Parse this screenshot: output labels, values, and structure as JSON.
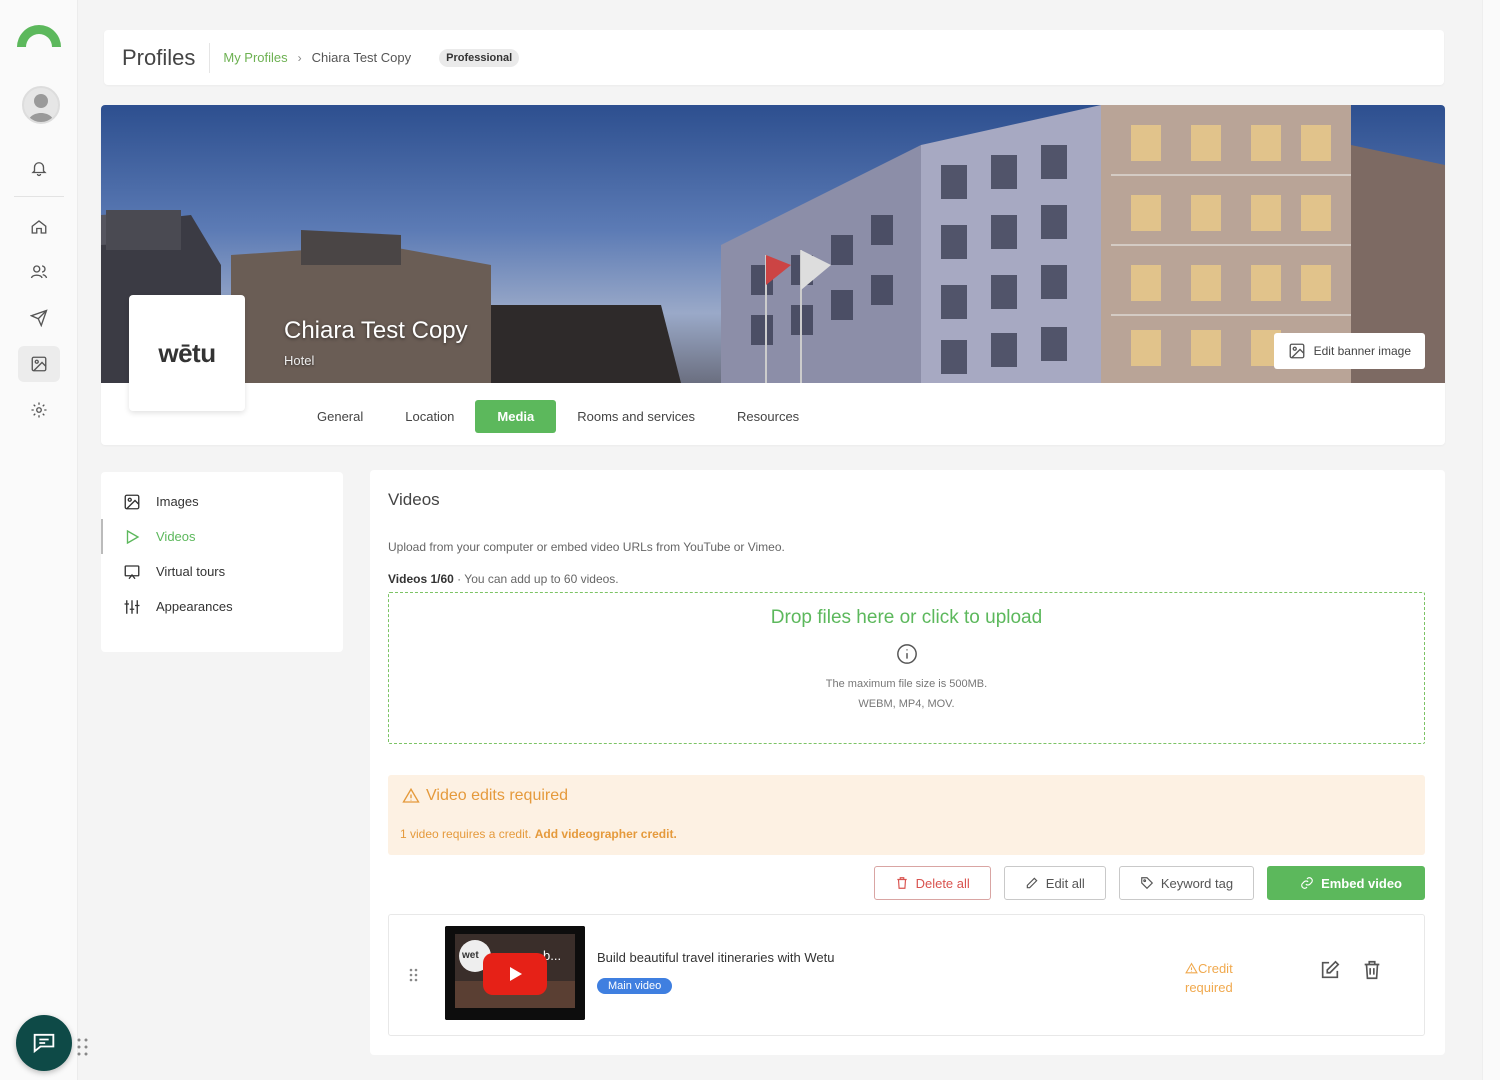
{
  "app": {
    "brand_color": "#5cb85c",
    "warning_color": "#e59a3c"
  },
  "rail": {
    "icons": [
      "logo-icon",
      "avatar",
      "bell-icon",
      "home-icon",
      "users-icon",
      "send-icon",
      "image-icon",
      "gear-icon"
    ],
    "active": "image-icon"
  },
  "header": {
    "title": "Profiles",
    "breadcrumb": {
      "link": "My Profiles",
      "separator": "›",
      "current": "Chiara Test Copy"
    },
    "badge": "Professional"
  },
  "profile": {
    "logo_text": "wētu",
    "name": "Chiara Test Copy",
    "type": "Hotel",
    "edit_banner_label": "Edit banner image"
  },
  "tabs": [
    {
      "label": "General"
    },
    {
      "label": "Location"
    },
    {
      "label": "Media",
      "active": true
    },
    {
      "label": "Rooms and services"
    },
    {
      "label": "Resources"
    }
  ],
  "sidemenu": [
    {
      "label": "Images",
      "icon": "image-icon"
    },
    {
      "label": "Videos",
      "icon": "play-icon",
      "active": true
    },
    {
      "label": "Virtual tours",
      "icon": "tour-icon"
    },
    {
      "label": "Appearances",
      "icon": "sliders-icon"
    }
  ],
  "videos": {
    "title": "Videos",
    "description": "Upload from your computer or embed video URLs from YouTube or Vimeo.",
    "count_label": "Videos 1/60",
    "count_note": "· You can add up to 60 videos.",
    "dropzone": {
      "title": "Drop files here or click to upload",
      "max_size": "The maximum file size is 500MB.",
      "formats": "WEBM, MP4, MOV."
    },
    "warning": {
      "title": "Video edits required",
      "text": "1 video requires a credit.",
      "link": "Add videographer credit."
    },
    "actions": {
      "delete_all": "Delete all",
      "edit_all": "Edit all",
      "keyword_tag": "Keyword tag",
      "embed": "Embed video"
    },
    "items": [
      {
        "title": "Build beautiful travel itineraries with Wetu",
        "badge": "Main video",
        "thumb_text": "wet",
        "thumb_text2": "b...",
        "credit_line1": "Credit",
        "credit_line2": "required"
      }
    ]
  }
}
